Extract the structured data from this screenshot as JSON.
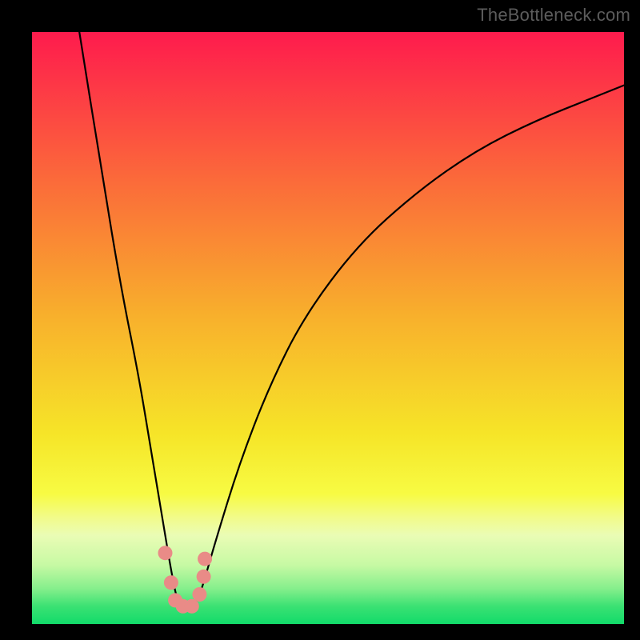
{
  "watermark": "TheBottleneck.com",
  "chart_data": {
    "type": "line",
    "title": "",
    "xlabel": "",
    "ylabel": "",
    "xlim": [
      0,
      100
    ],
    "ylim": [
      0,
      100
    ],
    "grid": false,
    "legend": false,
    "notes": "Rainbow vertical gradient (red→orange→yellow→green) background with a black V-shaped bottleneck curve. Values are approximate pixel-read estimates on a 0–100 normalized axis.",
    "series": [
      {
        "name": "bottleneck-curve",
        "color": "#000000",
        "x": [
          8,
          12,
          15,
          18,
          20,
          22,
          23.5,
          24.5,
          25.5,
          26.5,
          28,
          29,
          31,
          35,
          40,
          46,
          55,
          65,
          75,
          85,
          95,
          100
        ],
        "y": [
          100,
          75,
          57,
          42,
          30,
          18,
          9,
          4,
          2.5,
          2.5,
          4,
          7,
          14,
          27,
          40,
          52,
          64,
          73,
          80,
          85,
          89,
          91
        ]
      }
    ],
    "markers": [
      {
        "name": "pink-dot",
        "x": 22.5,
        "y": 12,
        "color": "#e98b87"
      },
      {
        "name": "pink-dot",
        "x": 23.5,
        "y": 7,
        "color": "#e98b87"
      },
      {
        "name": "pink-dot",
        "x": 24.2,
        "y": 4,
        "color": "#e98b87"
      },
      {
        "name": "pink-dot",
        "x": 25.5,
        "y": 3,
        "color": "#e98b87"
      },
      {
        "name": "pink-dot",
        "x": 27.0,
        "y": 3,
        "color": "#e98b87"
      },
      {
        "name": "pink-dot",
        "x": 28.3,
        "y": 5,
        "color": "#e98b87"
      },
      {
        "name": "pink-dot",
        "x": 29.0,
        "y": 8,
        "color": "#e98b87"
      },
      {
        "name": "pink-dot",
        "x": 29.2,
        "y": 11,
        "color": "#e98b87"
      }
    ],
    "background_gradient_stops": [
      {
        "offset": 0,
        "color": "#fe1b4d"
      },
      {
        "offset": 25,
        "color": "#fb6a3a"
      },
      {
        "offset": 48,
        "color": "#f8b02c"
      },
      {
        "offset": 68,
        "color": "#f6e528"
      },
      {
        "offset": 78,
        "color": "#f7fb43"
      },
      {
        "offset": 82,
        "color": "#f2fb8a"
      },
      {
        "offset": 85,
        "color": "#eafcb5"
      },
      {
        "offset": 90,
        "color": "#c7f9a4"
      },
      {
        "offset": 94,
        "color": "#86ef8c"
      },
      {
        "offset": 97,
        "color": "#3be173"
      },
      {
        "offset": 100,
        "color": "#12db6a"
      }
    ]
  }
}
